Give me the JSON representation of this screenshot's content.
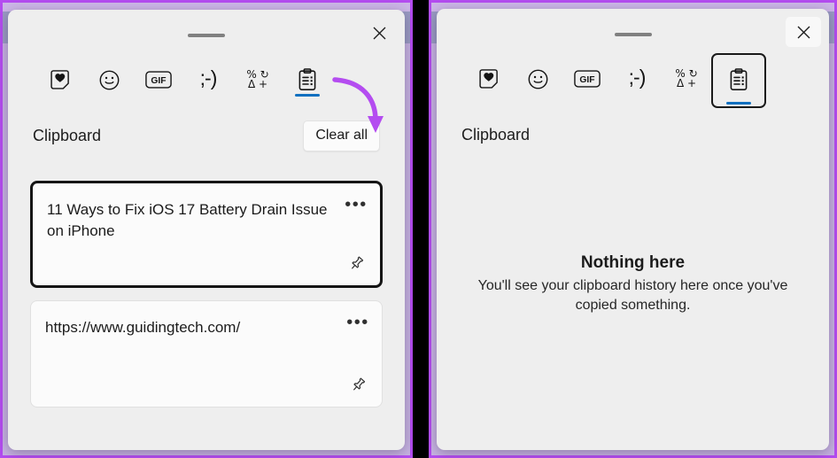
{
  "window": {
    "close_label": "×",
    "drag_handle": "drag-handle"
  },
  "tabs": [
    {
      "id": "stickers",
      "icon": "sticker-heart-icon",
      "label": "Stickers",
      "glyph": ""
    },
    {
      "id": "emoji",
      "icon": "smiley-face-icon",
      "label": "Emoji",
      "glyph": ""
    },
    {
      "id": "gif",
      "icon": "gif-icon",
      "label": "GIF",
      "glyph": "GIF"
    },
    {
      "id": "kaomoji",
      "icon": "kaomoji-icon",
      "label": "Kaomoji",
      "glyph": ";-)"
    },
    {
      "id": "symbols",
      "icon": "symbols-icon",
      "label": "Symbols",
      "glyph_top": "% ↻",
      "glyph_bottom": "Δ +"
    },
    {
      "id": "clipboard",
      "icon": "clipboard-icon",
      "label": "Clipboard",
      "glyph": ""
    }
  ],
  "left_panel": {
    "section_title": "Clipboard",
    "clear_all_label": "Clear all",
    "cards": [
      {
        "text": "11 Ways to Fix iOS 17 Battery Drain Issue on iPhone",
        "menu_label": "•••",
        "pin_label": "Pin item",
        "focused": true
      },
      {
        "text": "https://www.guidingtech.com/",
        "menu_label": "•••",
        "pin_label": "Pin item",
        "focused": false
      }
    ]
  },
  "right_panel": {
    "section_title": "Clipboard",
    "empty_title": "Nothing here",
    "empty_subtitle": "You'll see your clipboard history here once you've copied something."
  },
  "colors": {
    "annotation_purple": "#b44cf0",
    "tab_indicator_blue": "#1070c0",
    "window_background": "#eeeeee",
    "card_background": "#fbfbfb",
    "focus_black": "#151515"
  }
}
